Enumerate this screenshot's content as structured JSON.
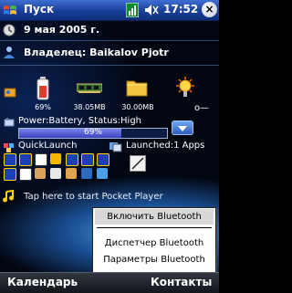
{
  "taskbar": {
    "start_label": "Пуск",
    "clock": "17:52",
    "close_label": "×"
  },
  "today": {
    "date": "9 мая 2005 г.",
    "owner": "Владелец: Baikalov Pjotr"
  },
  "status": {
    "battery_pct_label": "69%",
    "battery_pct_value": 69,
    "storage_label": "38.05MB",
    "folder_label": "30.00MB",
    "power_line": "Power:Battery, Status:High",
    "bar_label": "69%",
    "bar_fill_percent": 69
  },
  "quicklaunch": {
    "label": "QuickLaunch",
    "launched_label": "Launched:1 Apps"
  },
  "player": {
    "text": "Tap here to start Pocket Player"
  },
  "menu": {
    "items": [
      "Включить Bluetooth",
      "Диспетчер Bluetooth",
      "Параметры Bluetooth"
    ]
  },
  "softkeys": {
    "left": "Календарь",
    "right": "Контакты"
  },
  "colors": {
    "taskbar": "#1a3f9a",
    "bar_fill": "#3a41c4",
    "menu_bg": "#ffffff"
  }
}
